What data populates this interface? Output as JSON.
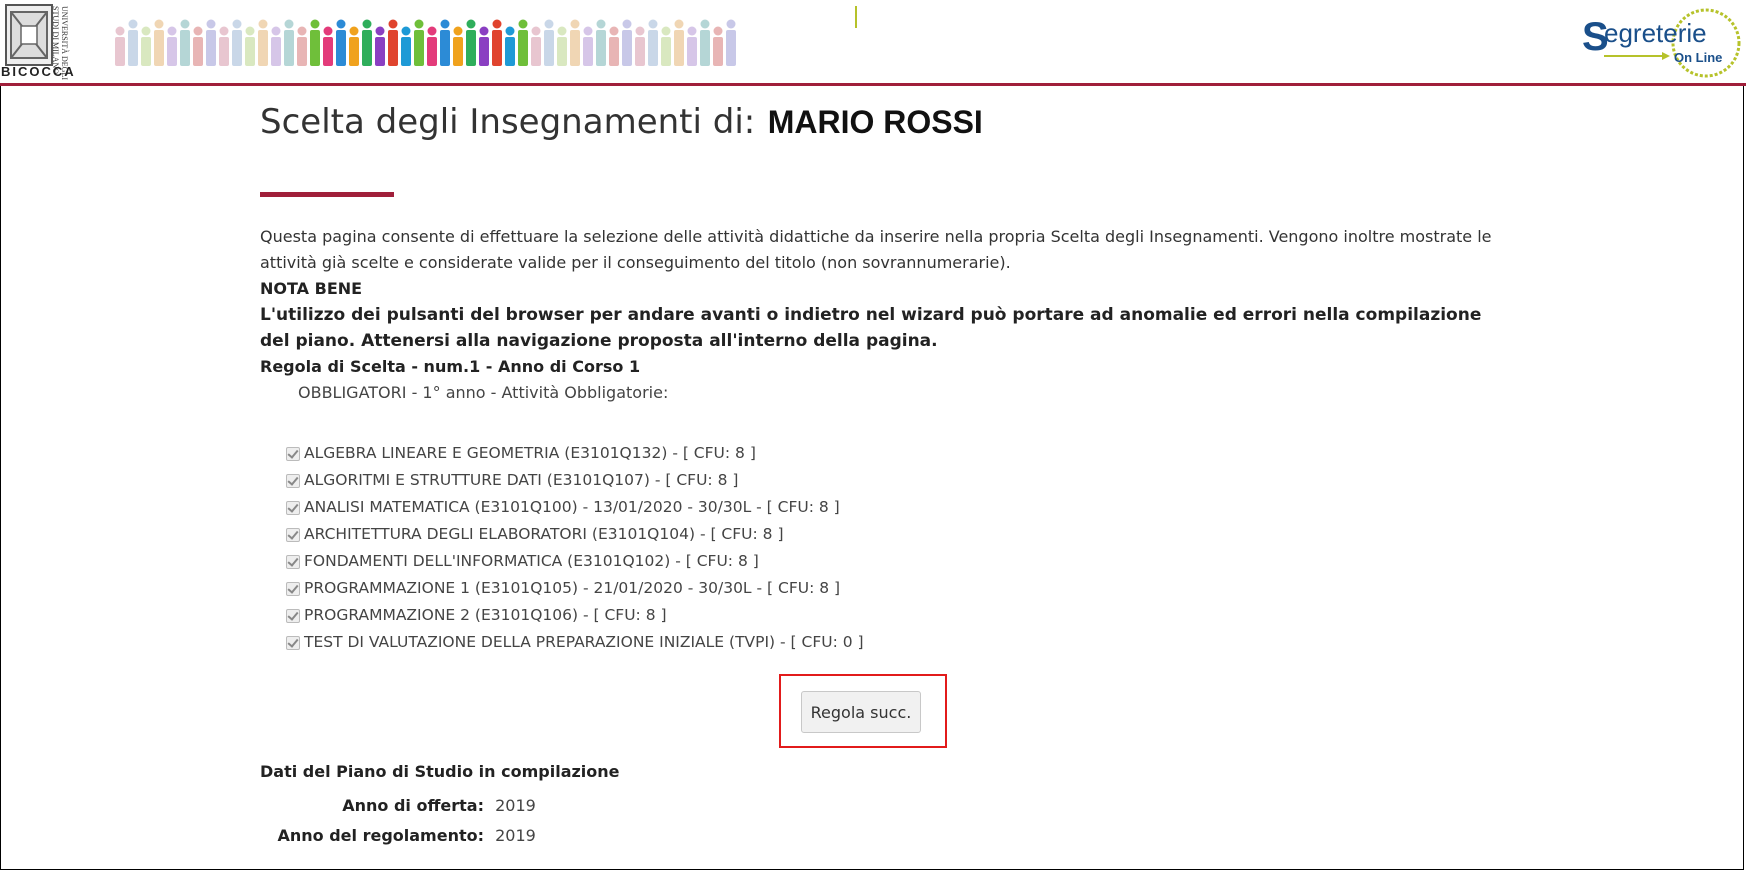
{
  "header": {
    "university_logo": {
      "icon": "university-crest-icon",
      "vertical_text": "UNIVERSITÀ DEGLI STUDI DI MILANO",
      "name": "BICOCCA"
    },
    "banner_icon": "crowd-illustration-icon",
    "right_logo": {
      "icon": "segreterie-online-logo-icon",
      "text_main": "Segreterie",
      "text_sub": "On Line"
    },
    "accent_color": "#a01f3a"
  },
  "page": {
    "title": "Scelta degli Insegnamenti di:",
    "student_name": "MARIO ROSSI",
    "description": "Questa pagina consente di effettuare la selezione delle attività didattiche da inserire nella propria Scelta degli Insegnamenti. Vengono inoltre mostrate le attività già scelte e considerate valide per il conseguimento del titolo (non sovrannumerarie).",
    "nota_bene": "NOTA BENE",
    "warning": "L'utilizzo dei pulsanti del browser per andare avanti o indietro nel wizard può portare ad anomalie ed errori nella compilazione del piano. Attenersi alla navigazione proposta all'interno della pagina.",
    "rule_title": "Regola di Scelta - num.1 - Anno di Corso 1",
    "rule_subtitle": "OBBLIGATORI - 1° anno - Attività Obbligatorie:"
  },
  "courses": [
    {
      "label": "ALGEBRA LINEARE E GEOMETRIA (E3101Q132) - [ CFU: 8 ]",
      "checked": true
    },
    {
      "label": "ALGORITMI E STRUTTURE DATI (E3101Q107) - [ CFU: 8 ]",
      "checked": true
    },
    {
      "label": "ANALISI MATEMATICA (E3101Q100) - 13/01/2020 - 30/30L - [ CFU: 8 ]",
      "checked": true
    },
    {
      "label": "ARCHITETTURA DEGLI ELABORATORI (E3101Q104) - [ CFU: 8 ]",
      "checked": true
    },
    {
      "label": "FONDAMENTI DELL'INFORMATICA (E3101Q102) - [ CFU: 8 ]",
      "checked": true
    },
    {
      "label": "PROGRAMMAZIONE 1 (E3101Q105) - 21/01/2020 - 30/30L - [ CFU: 8 ]",
      "checked": true
    },
    {
      "label": "PROGRAMMAZIONE 2 (E3101Q106) - [ CFU: 8 ]",
      "checked": true
    },
    {
      "label": "TEST DI VALUTAZIONE DELLA PREPARAZIONE INIZIALE (TVPI) - [ CFU: 0 ]",
      "checked": true
    }
  ],
  "actions": {
    "next_rule_label": "Regola succ.",
    "highlight_color": "#e21b1b"
  },
  "plan_data": {
    "heading": "Dati del Piano di Studio in compilazione",
    "rows": [
      {
        "label": "Anno di offerta:",
        "value": "2019"
      },
      {
        "label": "Anno del regolamento:",
        "value": "2019"
      }
    ]
  }
}
